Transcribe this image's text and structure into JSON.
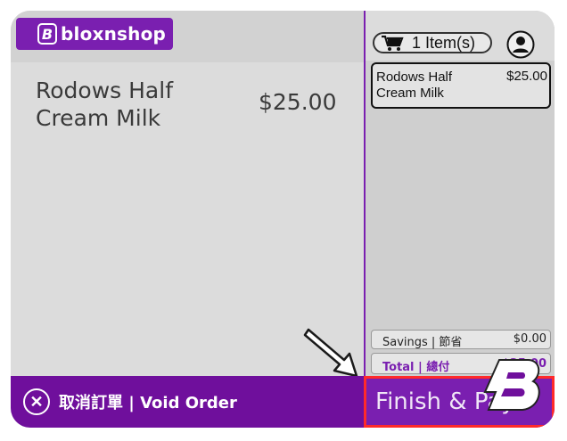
{
  "header": {
    "brand_letter": "B",
    "brand_name": "bloxnshop"
  },
  "product": {
    "name": "Rodows Half Cream Milk",
    "price": "$25.00"
  },
  "cart": {
    "count_label": "1 Item(s)",
    "items": [
      {
        "name": "Rodows Half Cream Milk",
        "price": "$25.00"
      }
    ]
  },
  "summary": {
    "savings_label": "Savings | 節省",
    "savings_value": "$0.00",
    "total_label": "Total | 總付",
    "total_value": "$25.00"
  },
  "actions": {
    "void_label": "取消訂單 | Void Order",
    "finish_label": "Finish & Pay"
  },
  "icons": [
    "cart-icon",
    "user-icon",
    "close-icon",
    "chevron-right-icon",
    "pointer-arrow-icon",
    "b-watermark-icon"
  ],
  "colors": {
    "accent": "#7a1fb0",
    "highlight": "#ff2a2a"
  }
}
